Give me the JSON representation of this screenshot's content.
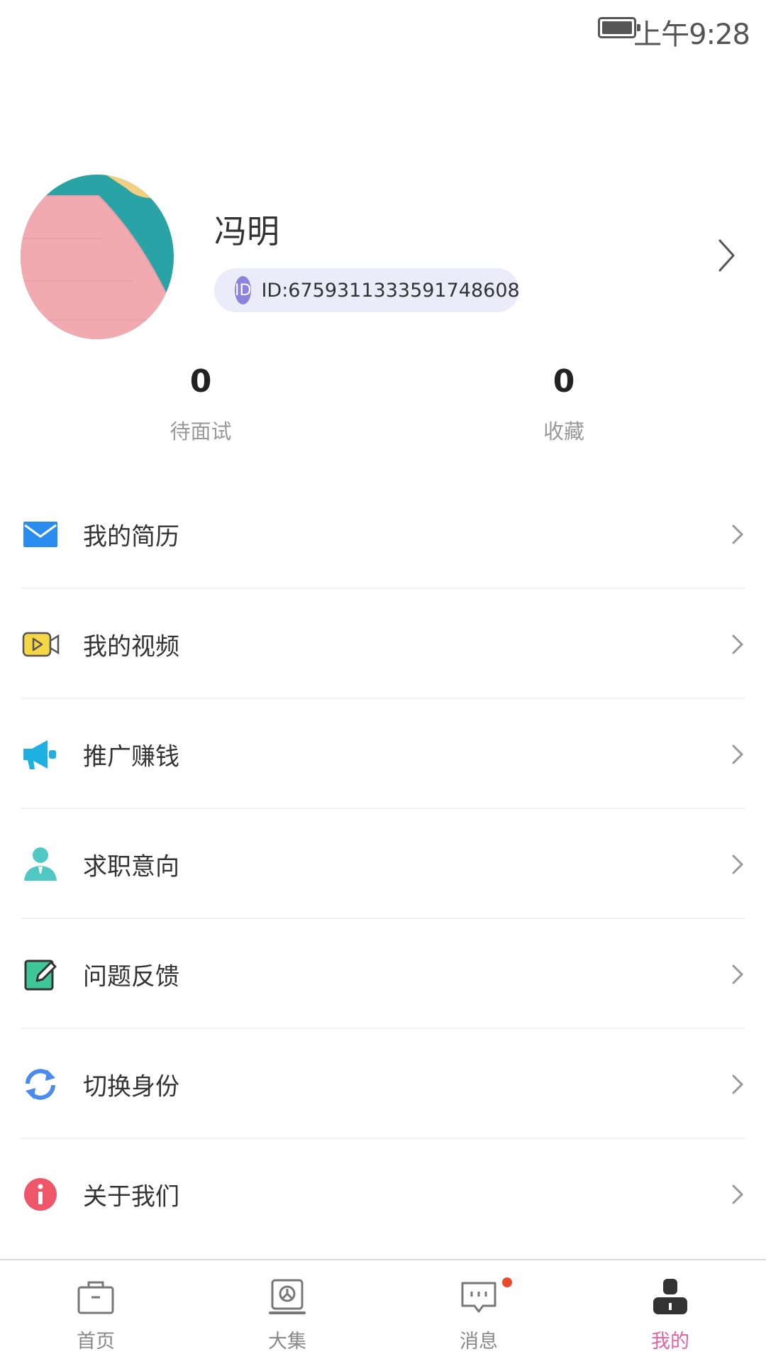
{
  "status_bar": {
    "time": "上午9:28",
    "battery_icon": "battery-icon"
  },
  "profile": {
    "name": "冯明",
    "id_badge": "ID",
    "id_text": "ID:6759311333591748608",
    "avatar": "avatar-image"
  },
  "stats": [
    {
      "value": "0",
      "label": "待面试"
    },
    {
      "value": "0",
      "label": "收藏"
    }
  ],
  "menu": [
    {
      "label": "我的简历",
      "icon": "mail-icon"
    },
    {
      "label": "我的视频",
      "icon": "video-icon"
    },
    {
      "label": "推广赚钱",
      "icon": "megaphone-icon"
    },
    {
      "label": "求职意向",
      "icon": "user-icon"
    },
    {
      "label": "问题反馈",
      "icon": "edit-icon"
    },
    {
      "label": "切换身份",
      "icon": "refresh-icon"
    },
    {
      "label": "关于我们",
      "icon": "info-icon"
    }
  ],
  "bottom_nav": [
    {
      "label": "首页",
      "icon": "briefcase-icon"
    },
    {
      "label": "大集",
      "icon": "market-icon"
    },
    {
      "label": "消息",
      "icon": "message-icon",
      "has_badge": true
    },
    {
      "label": "我的",
      "icon": "profile-icon",
      "active": true
    }
  ],
  "colors": {
    "accent_active_tab": "#e462a2",
    "id_pill_bg": "#ecebf9",
    "id_badge_bg": "#8c83dc",
    "badge_dot": "#ec4a2b"
  }
}
